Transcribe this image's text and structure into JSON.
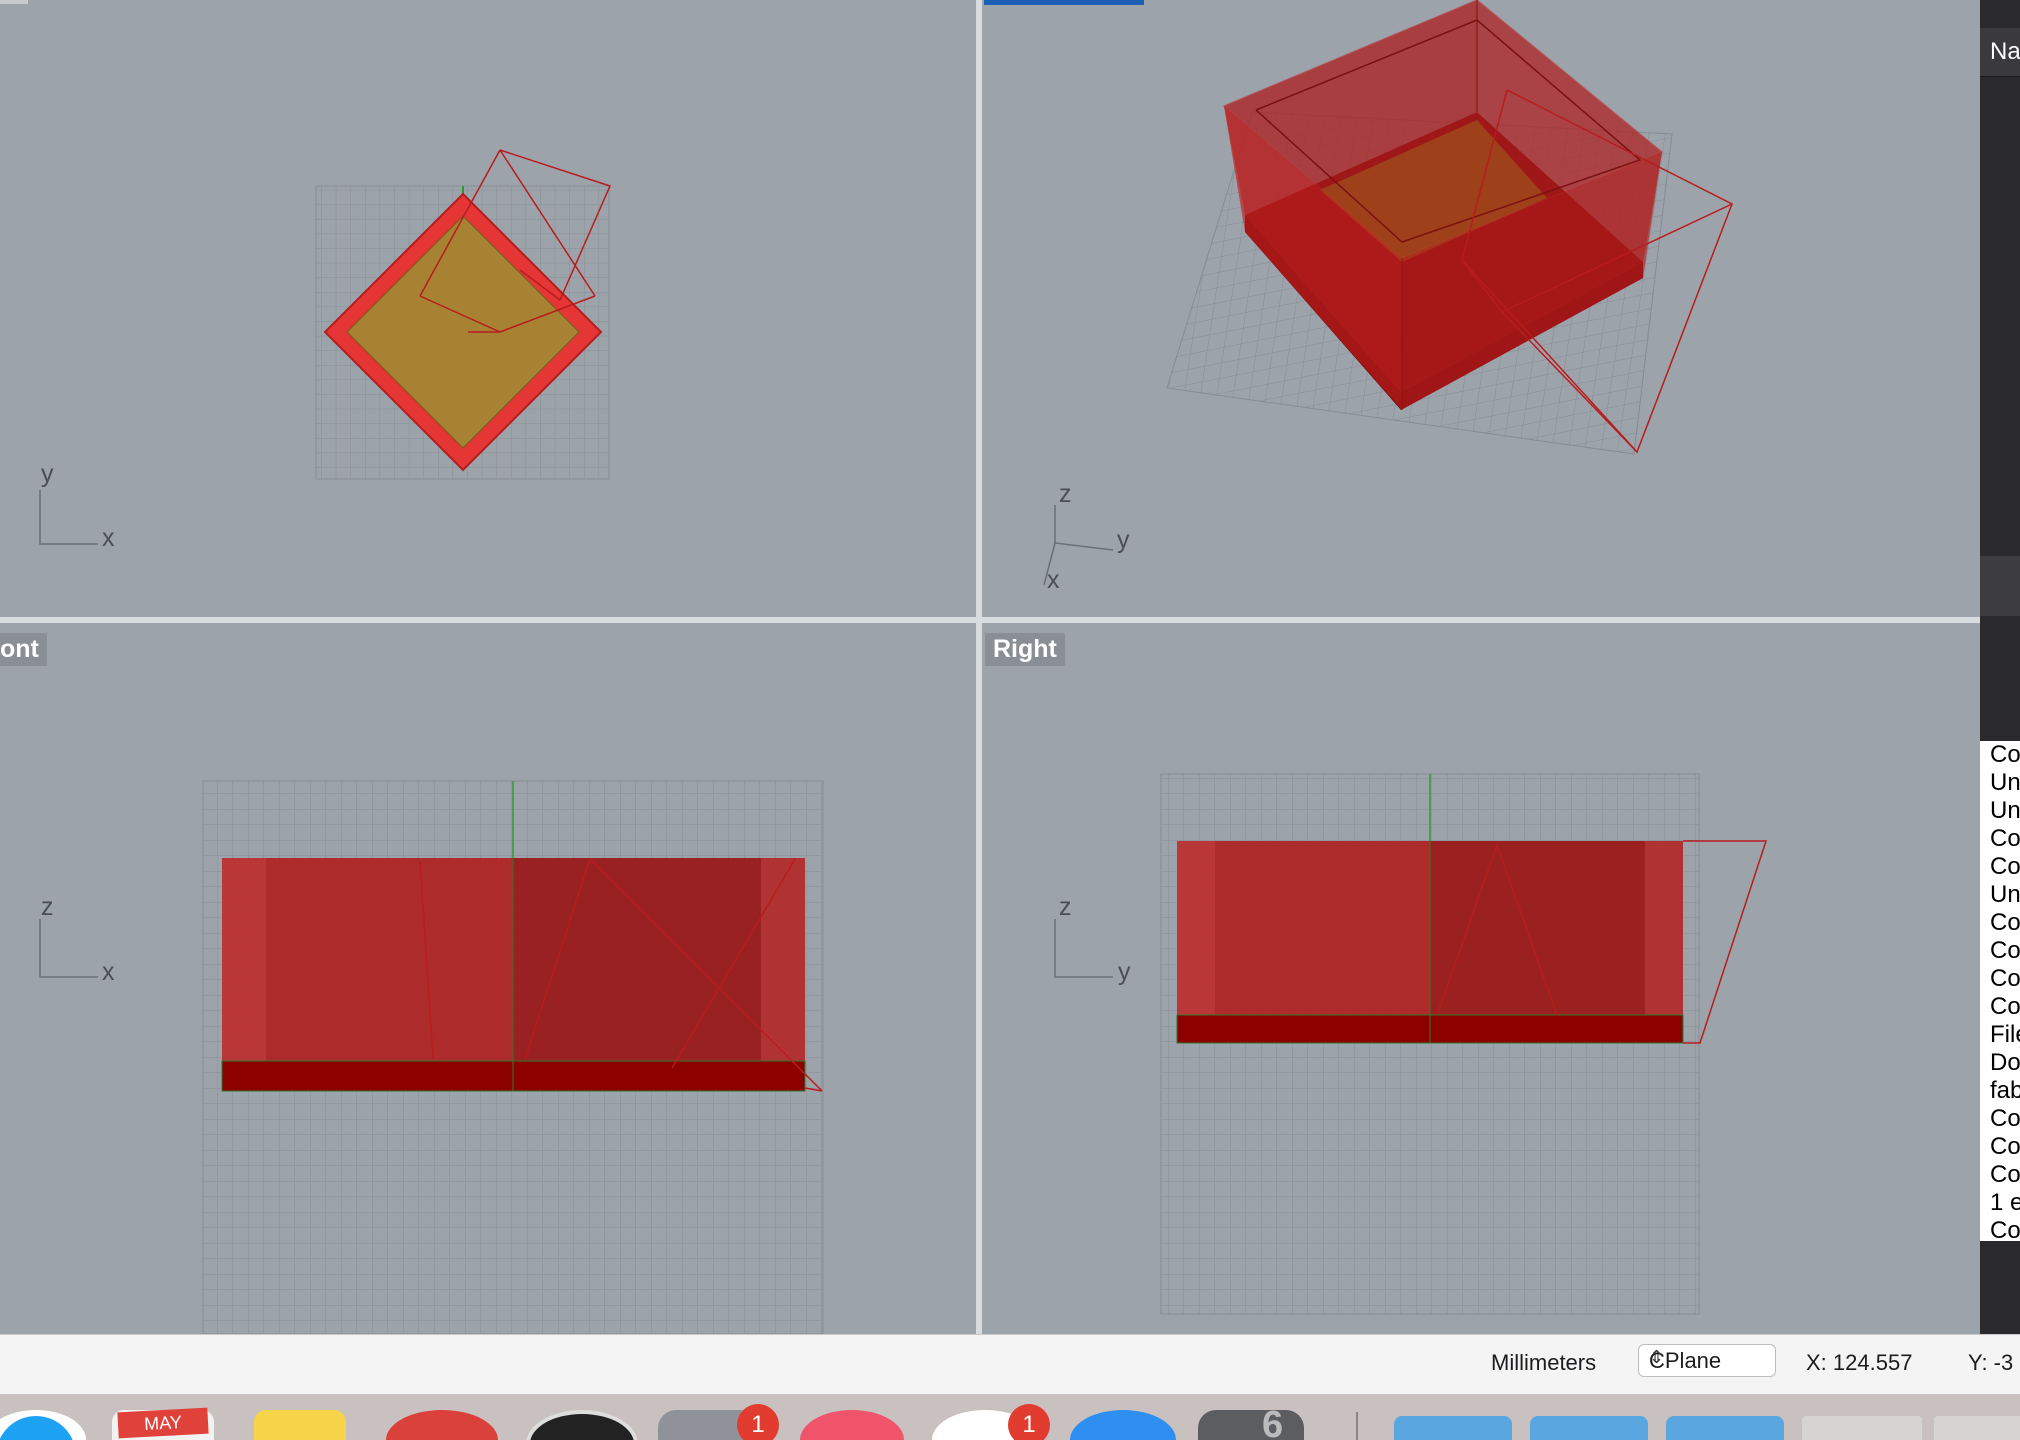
{
  "viewports": {
    "top": {
      "axes": {
        "v": "y",
        "h": "x"
      }
    },
    "perspective": {
      "axes": {
        "v": "z",
        "h": "y",
        "d": "x"
      }
    },
    "front": {
      "label": "ont",
      "axes": {
        "v": "z",
        "h": "x"
      }
    },
    "right": {
      "label": "Right",
      "axes": {
        "v": "z",
        "h": "y"
      }
    }
  },
  "sidebar": {
    "header": "Na",
    "command_history": [
      "Co",
      "Un",
      "Un",
      "Co",
      "Co",
      "Un",
      "Co",
      "Co",
      "Co",
      "Co",
      "File",
      "Do",
      "fab",
      "Co",
      "Co",
      "Co",
      "1 e",
      "Co"
    ]
  },
  "status_bar": {
    "units": "Millimeters",
    "cplane": "CPlane",
    "x": "X: 124.557",
    "y": "Y: -3"
  },
  "dock": {
    "calendar_month": "MAY",
    "badges": [
      "1",
      "1"
    ],
    "version_digit": "6"
  },
  "colors": {
    "viewport_bg": "#9da3ab",
    "object_red": "#c81e1e",
    "accent_blue": "#1d5fb4"
  }
}
